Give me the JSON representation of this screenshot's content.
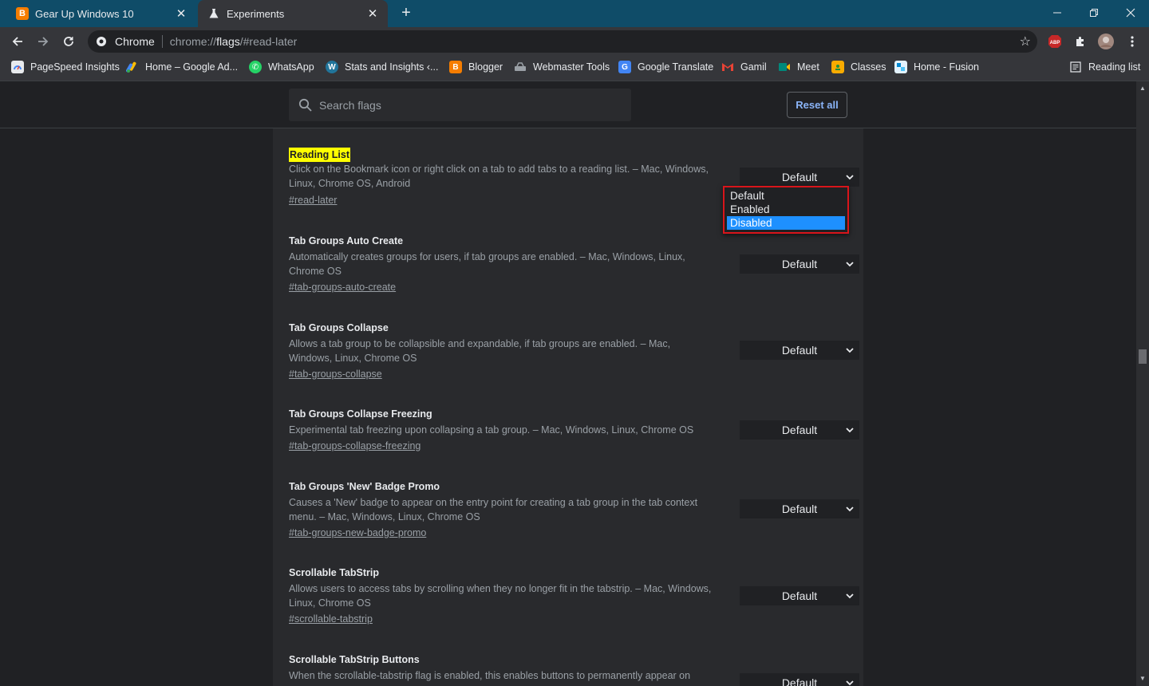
{
  "tabs": [
    {
      "title": "Gear Up Windows 10",
      "icon": "blogger-icon",
      "active": false
    },
    {
      "title": "Experiments",
      "icon": "flask-icon",
      "active": true
    }
  ],
  "toolbar": {
    "site_chip": "Chrome",
    "url_prefix": "chrome://",
    "url_host": "flags",
    "url_rest": "/#read-later",
    "extensions": [
      "adblock-icon",
      "puzzle-icon",
      "avatar"
    ]
  },
  "bookmarks": [
    {
      "label": "PageSpeed Insights",
      "icon": "pagespeed-icon",
      "color": "#4285f4"
    },
    {
      "label": "Home – Google Ad...",
      "icon": "google-ads-icon",
      "color": "#fbbc04"
    },
    {
      "label": "WhatsApp",
      "icon": "whatsapp-icon",
      "color": "#25d366"
    },
    {
      "label": "Stats and Insights ‹...",
      "icon": "wordpress-icon",
      "color": "#21759b"
    },
    {
      "label": "Blogger",
      "icon": "blogger-icon",
      "color": "#f57d00"
    },
    {
      "label": "Webmaster Tools",
      "icon": "webmaster-icon",
      "color": "#9aa0a6"
    },
    {
      "label": "Google Translate",
      "icon": "translate-icon",
      "color": "#4285f4"
    },
    {
      "label": "Gamil",
      "icon": "gmail-icon",
      "color": "#ea4335"
    },
    {
      "label": "Meet",
      "icon": "meet-icon",
      "color": "#00897b"
    },
    {
      "label": "Classes",
      "icon": "classroom-icon",
      "color": "#f9ab00"
    },
    {
      "label": "Home - Fusion",
      "icon": "fusion-icon",
      "color": "#4fc3f7"
    }
  ],
  "reading_list_label": "Reading list",
  "search": {
    "placeholder": "Search flags"
  },
  "reset_label": "Reset all",
  "flags": [
    {
      "name": "Reading List",
      "desc": "Click on the Bookmark icon or right click on a tab to add tabs to a reading list. – Mac, Windows, Linux, Chrome OS, Android",
      "link": "#read-later",
      "value": "Default"
    },
    {
      "name": "Tab Groups Auto Create",
      "desc": "Automatically creates groups for users, if tab groups are enabled. – Mac, Windows, Linux, Chrome OS",
      "link": "#tab-groups-auto-create",
      "value": "Default"
    },
    {
      "name": "Tab Groups Collapse",
      "desc": "Allows a tab group to be collapsible and expandable, if tab groups are enabled. – Mac, Windows, Linux, Chrome OS",
      "link": "#tab-groups-collapse",
      "value": "Default"
    },
    {
      "name": "Tab Groups Collapse Freezing",
      "desc": "Experimental tab freezing upon collapsing a tab group. – Mac, Windows, Linux, Chrome OS",
      "link": "#tab-groups-collapse-freezing",
      "value": "Default"
    },
    {
      "name": "Tab Groups 'New' Badge Promo",
      "desc": "Causes a 'New' badge to appear on the entry point for creating a tab group in the tab context menu. – Mac, Windows, Linux, Chrome OS",
      "link": "#tab-groups-new-badge-promo",
      "value": "Default"
    },
    {
      "name": "Scrollable TabStrip",
      "desc": "Allows users to access tabs by scrolling when they no longer fit in the tabstrip. – Mac, Windows, Linux, Chrome OS",
      "link": "#scrollable-tabstrip",
      "value": "Default"
    },
    {
      "name": "Scrollable TabStrip Buttons",
      "desc": "When the scrollable-tabstrip flag is enabled, this enables buttons to permanently appear on",
      "link": "",
      "value": "Default"
    }
  ],
  "dropdown": {
    "options": [
      "Default",
      "Enabled",
      "Disabled"
    ],
    "highlighted": "Disabled"
  },
  "colors": {
    "highlight": "#ffff00",
    "accent": "#8ab4f8",
    "selection": "#1e90ff",
    "annotation_border": "#d8151b"
  }
}
